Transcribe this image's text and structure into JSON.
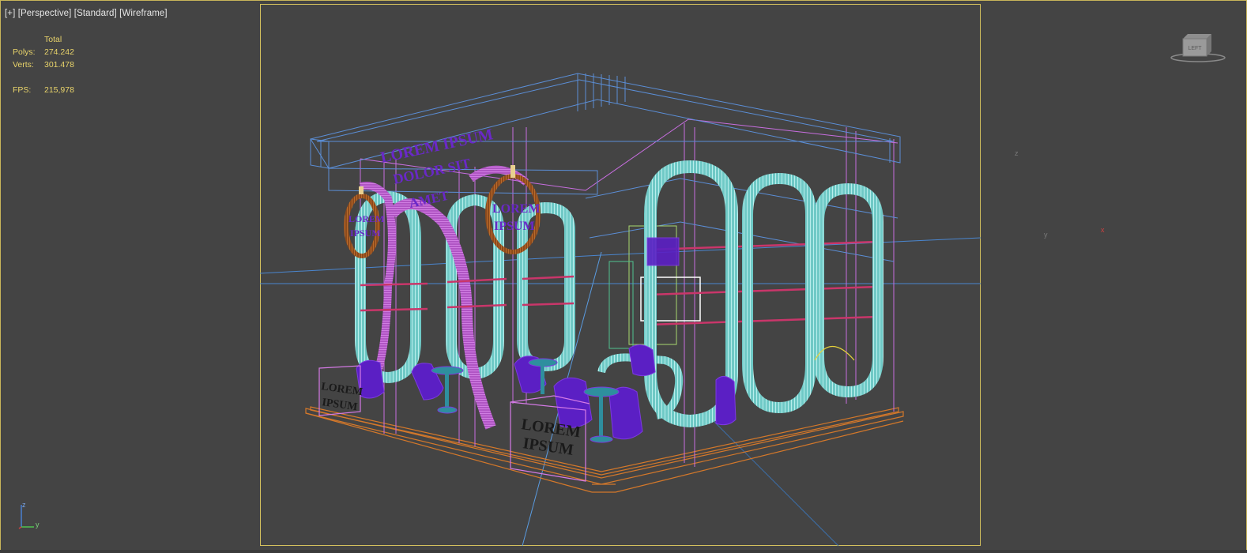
{
  "viewport": {
    "label_plus": "[+]",
    "label_view": "[Perspective]",
    "label_shading_mode": "[Standard]",
    "label_render_style": "[Wireframe]"
  },
  "stats": {
    "header": "Total",
    "polys_label": "Polys:",
    "polys_value": "274.242",
    "verts_label": "Verts:",
    "verts_value": "301.478",
    "fps_label": "FPS:",
    "fps_value": "215,978"
  },
  "viewcube": {
    "label": "LEFT"
  },
  "axis_triad": {
    "z": "z",
    "y": "y"
  },
  "gizmo_labels": {
    "z": "z",
    "y": "y",
    "x": "x"
  },
  "scene": {
    "sign_top": [
      "LOREM IPSUM",
      "DOLOR SIT",
      "AMET"
    ],
    "ring_left": [
      "LOREM",
      "IPSUM"
    ],
    "ring_right": [
      "LOREM",
      "IPSUM"
    ],
    "counter_left": [
      "LOREM",
      "IPSUM"
    ],
    "counter_front": [
      "LOREM",
      "IPSUM"
    ]
  },
  "colors": {
    "background": "#444444",
    "frame": "#d4c15e",
    "stats_text": "#e8d36a",
    "wire_blue": "#5b8ed6",
    "wire_pink": "#d57ae6",
    "wire_cyan": "#a8f0ec",
    "wire_orange": "#d47a2e",
    "fill_purple": "#5b1fc4",
    "shelf_red": "#c9366a"
  }
}
